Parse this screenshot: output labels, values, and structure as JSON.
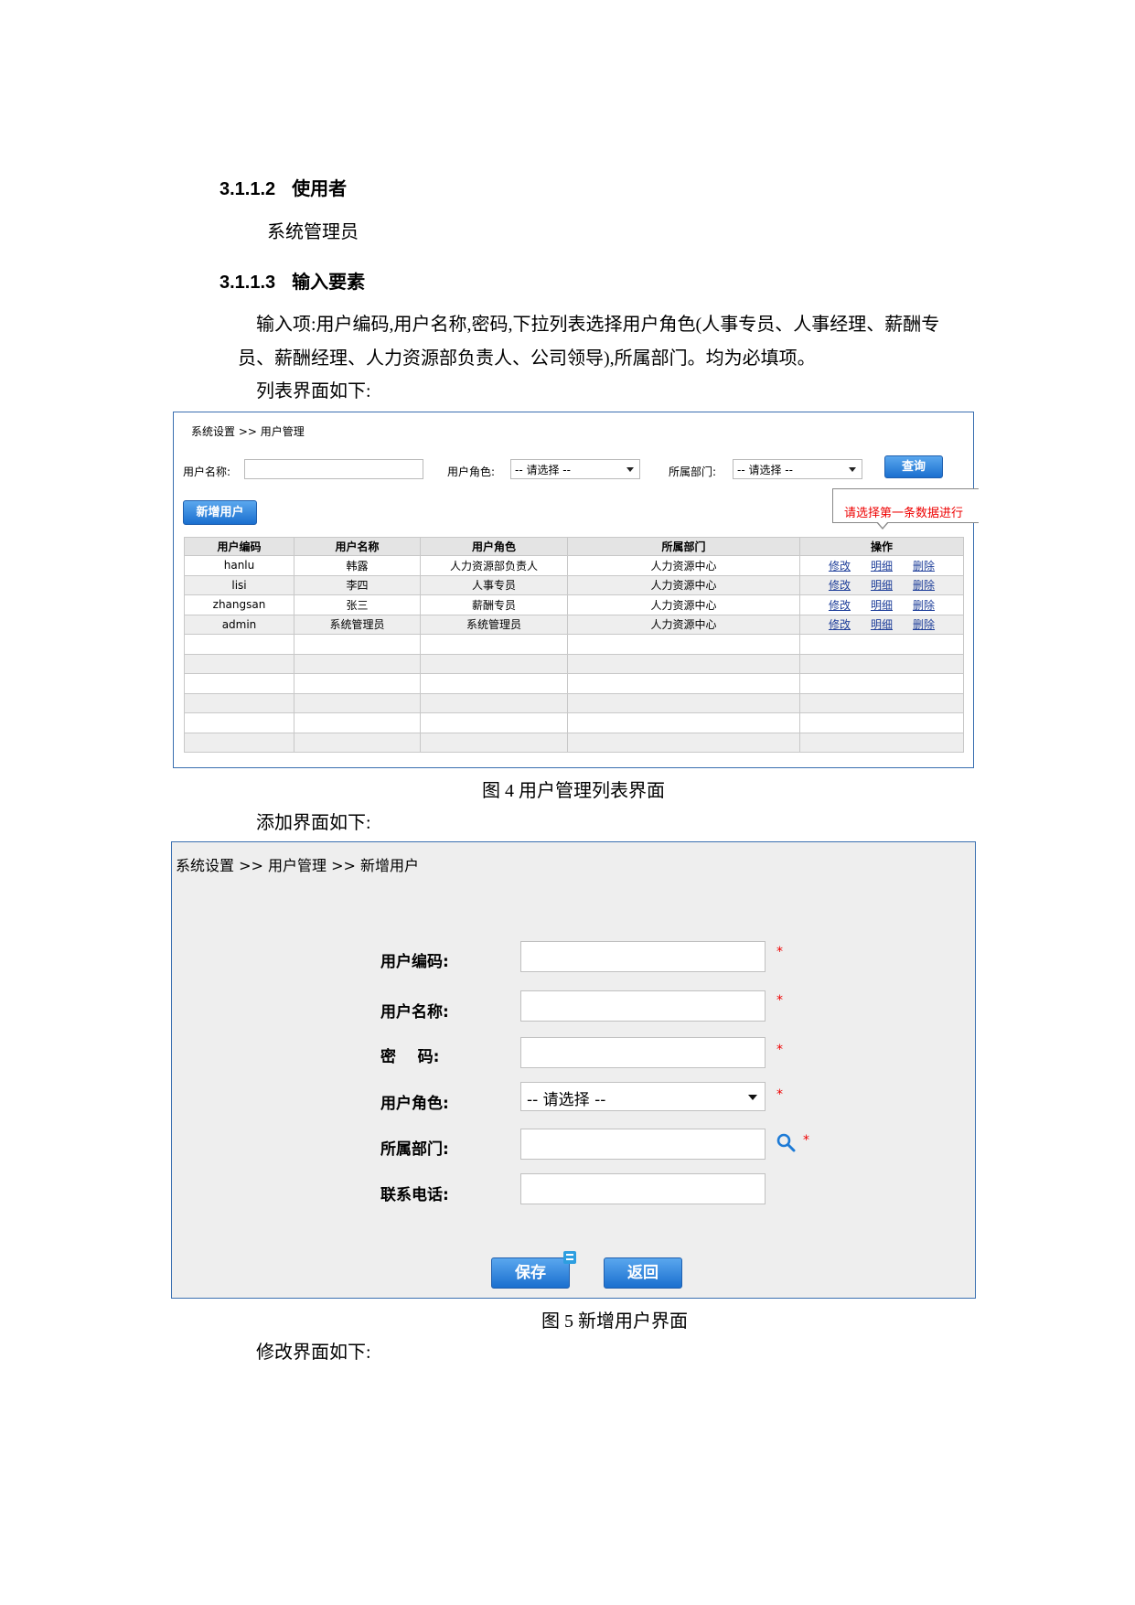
{
  "doc": {
    "h1": {
      "num": "3.1.1.2",
      "title": "使用者"
    },
    "p1": "系统管理员",
    "h2": {
      "num": "3.1.1.3",
      "title": "输入要素"
    },
    "p2_line1": "输入项:用户编码,用户名称,密码,下拉列表选择用户角色(人事专员、人事经理、薪酬专",
    "p2_line2": "员、薪酬经理、人力资源部负责人、公司领导),所属部门。均为必填项。",
    "p3": "列表界面如下:",
    "caption4": "图 4  用户管理列表界面",
    "p4": "添加界面如下:",
    "caption5": "图 5  新增用户界面",
    "p5": "修改界面如下:"
  },
  "list_screen": {
    "breadcrumb": "系统设置 >> 用户管理",
    "search": {
      "name_label": "用户名称:",
      "name_value": "",
      "role_label": "用户角色:",
      "role_value": "-- 请选择 --",
      "dept_label": "所属部门:",
      "dept_value": "-- 请选择 --",
      "query_button": "查询"
    },
    "add_button": "新增用户",
    "tooltip": "请选择第一条数据进行",
    "columns": [
      "用户编码",
      "用户名称",
      "用户角色",
      "所属部门",
      "操作"
    ],
    "rows": [
      {
        "code": "hanlu",
        "name": "韩露",
        "role": "人力资源部负责人",
        "dept": "人力资源中心"
      },
      {
        "code": "lisi",
        "name": "李四",
        "role": "人事专员",
        "dept": "人力资源中心"
      },
      {
        "code": "zhangsan",
        "name": "张三",
        "role": "薪酬专员",
        "dept": "人力资源中心"
      },
      {
        "code": "admin",
        "name": "系统管理员",
        "role": "系统管理员",
        "dept": "人力资源中心"
      }
    ],
    "actions": {
      "edit": "修改",
      "detail": "明细",
      "delete": "删除"
    }
  },
  "add_screen": {
    "breadcrumb": "系统设置 >> 用户管理 >> 新增用户",
    "fields": {
      "code": "用户编码:",
      "name": "用户名称:",
      "password": "密    码:",
      "role": "用户角色:",
      "dept": "所属部门:",
      "phone": "联系电话:"
    },
    "role_value": "-- 请选择 --",
    "required_mark": "*",
    "save_button": "保存",
    "back_button": "返回"
  },
  "colors": {
    "frame_border": "#3a6fb0",
    "button_blue": "#1a6fcf",
    "required_red": "#e00000",
    "link_blue": "#1f3f9a"
  },
  "icons": [
    "search-icon",
    "dropdown-arrow-icon",
    "note-badge-icon"
  ]
}
